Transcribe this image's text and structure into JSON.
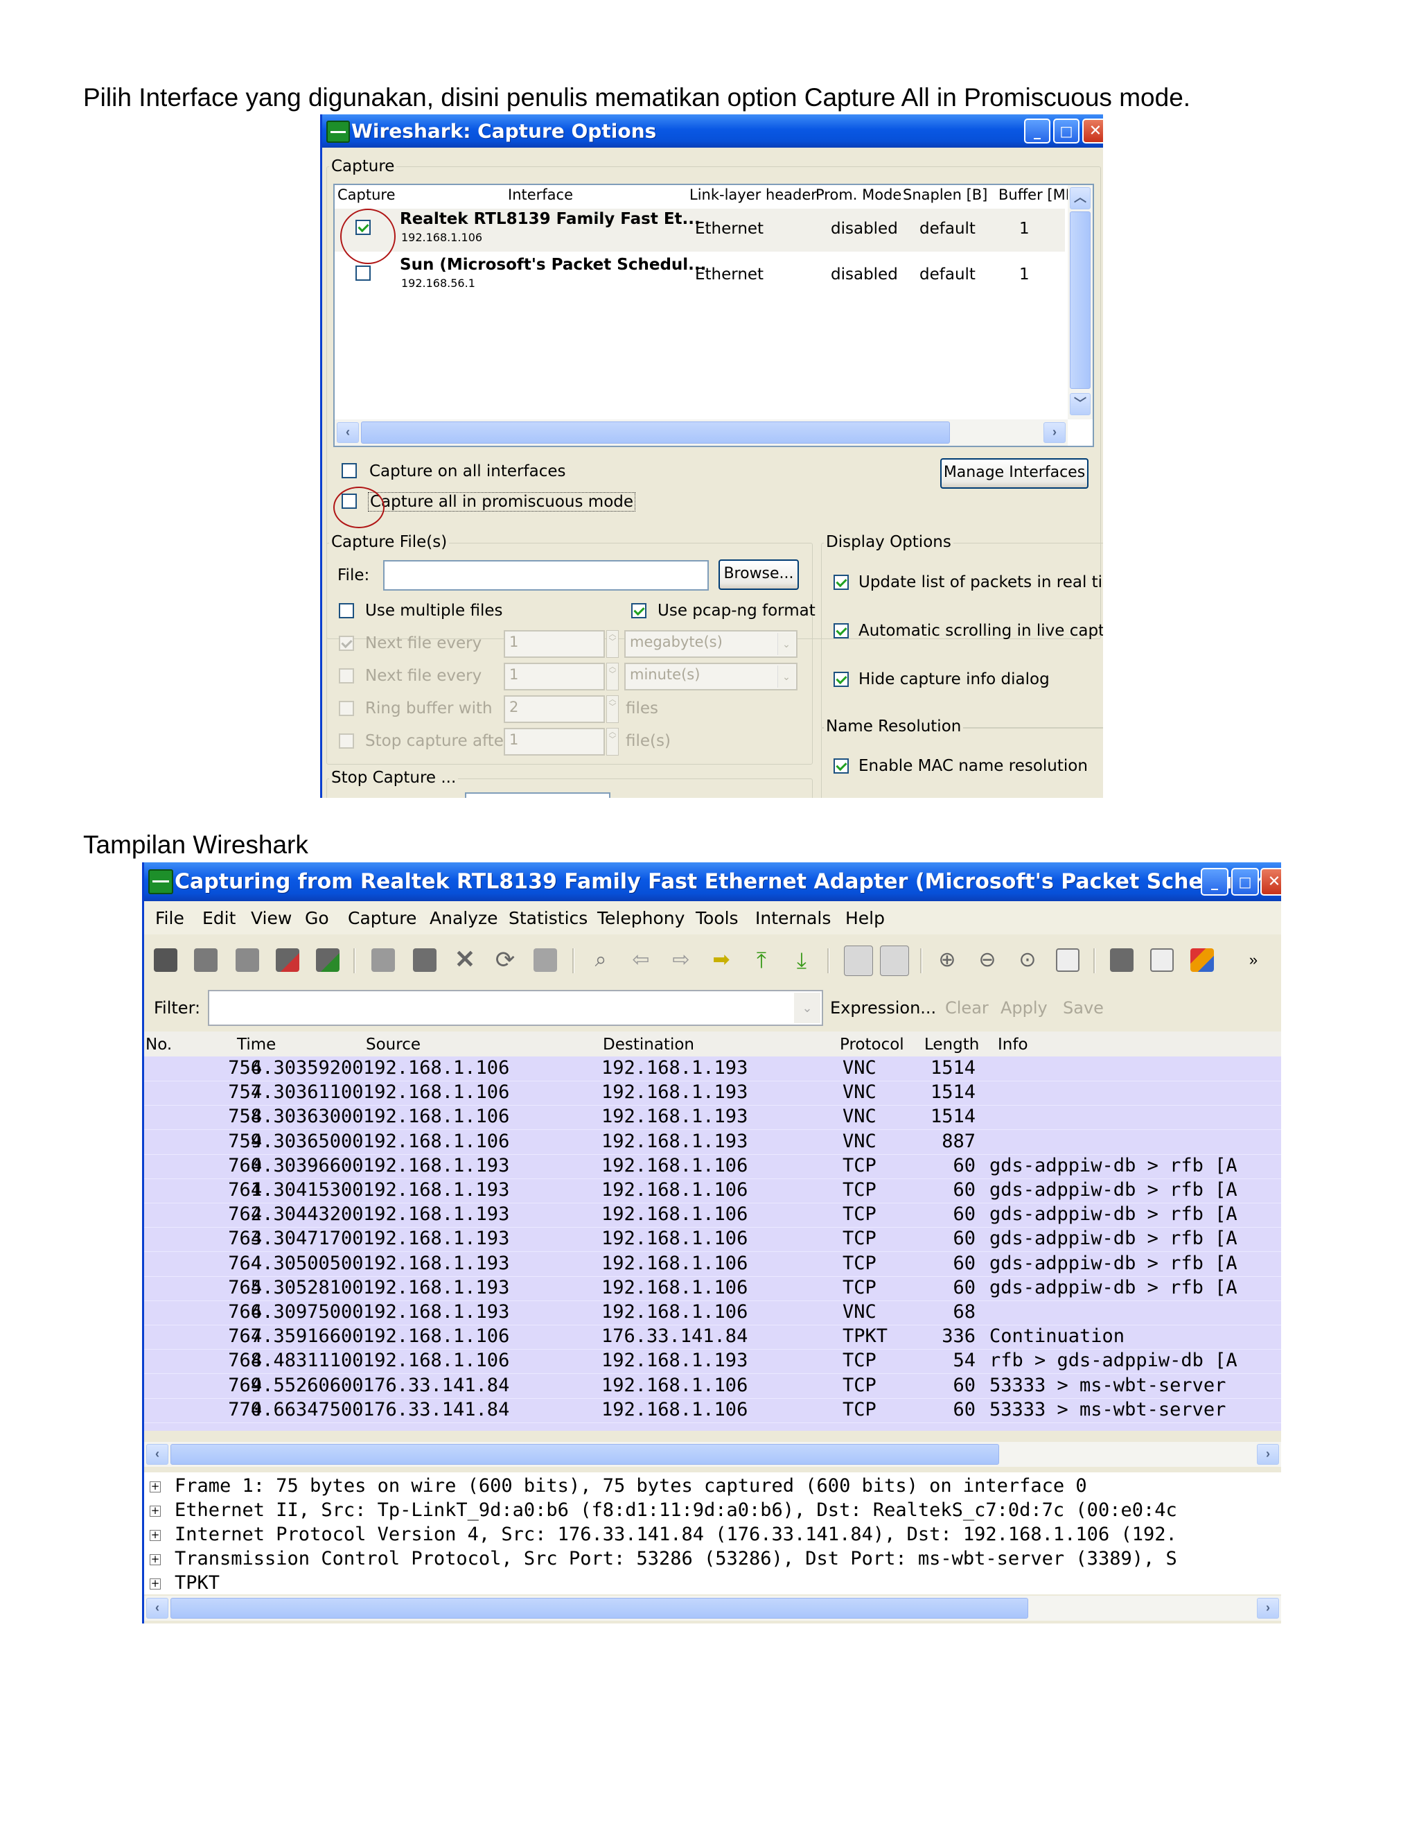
{
  "doc": {
    "intro_text": "Pilih Interface yang digunakan, disini penulis mematikan option Capture All in Promiscuous mode.",
    "section_title": "Tampilan Wireshark"
  },
  "options_dialog": {
    "title": "Wireshark: Capture Options",
    "capture_group": "Capture",
    "columns": [
      "Capture",
      "Interface",
      "Link-layer header",
      "Prom. Mode",
      "Snaplen [B]",
      "Buffer [MB"
    ],
    "interfaces": [
      {
        "name": "Realtek RTL8139 Family Fast Et...",
        "ip": "192.168.1.106",
        "link": "Ethernet",
        "prom": "disabled",
        "snaplen": "default",
        "buffer": "1",
        "checked": true
      },
      {
        "name": "Sun (Microsoft's Packet Schedul...",
        "ip": "192.168.56.1",
        "link": "Ethernet",
        "prom": "disabled",
        "snaplen": "default",
        "buffer": "1",
        "checked": false
      }
    ],
    "capture_all_interfaces": "Capture on all interfaces",
    "capture_promiscuous": "Capture all in promiscuous mode",
    "manage_interfaces": "Manage Interfaces",
    "capture_files_group": "Capture File(s)",
    "file_label": "File:",
    "file_value": "",
    "browse": "Browse...",
    "use_multiple_files": "Use multiple files",
    "use_pcapng": "Use pcap-ng format",
    "next_file_every_1": "Next file every",
    "next_file_every_1_value": "1",
    "next_file_every_1_unit": "megabyte(s)",
    "next_file_every_2": "Next file every",
    "next_file_every_2_value": "1",
    "next_file_every_2_unit": "minute(s)",
    "ring_buffer": "Ring buffer with",
    "ring_buffer_value": "2",
    "ring_buffer_unit": "files",
    "stop_capture_after": "Stop capture after",
    "stop_capture_after_value": "1",
    "stop_capture_after_unit": "file(s)",
    "stop_capture_group": "Stop Capture ...",
    "display_options_group": "Display Options",
    "update_realtime": "Update list of packets in real time",
    "auto_scroll": "Automatic scrolling in live capture",
    "hide_info": "Hide capture info dialog",
    "name_resolution_group": "Name Resolution",
    "mac_resolution": "Enable MAC name resolution"
  },
  "main_window": {
    "title": "Capturing from Realtek RTL8139 Family Fast Ethernet Adapter (Microsoft's Packet Scheduler) : \\Device\\...",
    "menu": [
      "File",
      "Edit",
      "View",
      "Go",
      "Capture",
      "Analyze",
      "Statistics",
      "Telephony",
      "Tools",
      "Internals",
      "Help"
    ],
    "filter_label": "Filter:",
    "filter_value": "",
    "expression": "Expression...",
    "clear": "Clear",
    "apply": "Apply",
    "save": "Save",
    "columns": [
      "No.",
      "Time",
      "Source",
      "Destination",
      "Protocol",
      "Length",
      "Info"
    ],
    "packets": [
      {
        "no": "756",
        "time": "4.30359200",
        "src": "192.168.1.106",
        "dst": "192.168.1.193",
        "proto": "VNC",
        "len": "1514",
        "info": ""
      },
      {
        "no": "757",
        "time": "4.30361100",
        "src": "192.168.1.106",
        "dst": "192.168.1.193",
        "proto": "VNC",
        "len": "1514",
        "info": ""
      },
      {
        "no": "758",
        "time": "4.30363000",
        "src": "192.168.1.106",
        "dst": "192.168.1.193",
        "proto": "VNC",
        "len": "1514",
        "info": ""
      },
      {
        "no": "759",
        "time": "4.30365000",
        "src": "192.168.1.106",
        "dst": "192.168.1.193",
        "proto": "VNC",
        "len": "887",
        "info": ""
      },
      {
        "no": "760",
        "time": "4.30396600",
        "src": "192.168.1.193",
        "dst": "192.168.1.106",
        "proto": "TCP",
        "len": "60",
        "info": "gds-adppiw-db > rfb [A"
      },
      {
        "no": "761",
        "time": "4.30415300",
        "src": "192.168.1.193",
        "dst": "192.168.1.106",
        "proto": "TCP",
        "len": "60",
        "info": "gds-adppiw-db > rfb [A"
      },
      {
        "no": "762",
        "time": "4.30443200",
        "src": "192.168.1.193",
        "dst": "192.168.1.106",
        "proto": "TCP",
        "len": "60",
        "info": "gds-adppiw-db > rfb [A"
      },
      {
        "no": "763",
        "time": "4.30471700",
        "src": "192.168.1.193",
        "dst": "192.168.1.106",
        "proto": "TCP",
        "len": "60",
        "info": "gds-adppiw-db > rfb [A"
      },
      {
        "no": "764",
        "time": "4.30500500",
        "src": "192.168.1.193",
        "dst": "192.168.1.106",
        "proto": "TCP",
        "len": "60",
        "info": "gds-adppiw-db > rfb [A"
      },
      {
        "no": "765",
        "time": "4.30528100",
        "src": "192.168.1.193",
        "dst": "192.168.1.106",
        "proto": "TCP",
        "len": "60",
        "info": "gds-adppiw-db > rfb [A"
      },
      {
        "no": "766",
        "time": "4.30975000",
        "src": "192.168.1.193",
        "dst": "192.168.1.106",
        "proto": "VNC",
        "len": "68",
        "info": ""
      },
      {
        "no": "767",
        "time": "4.35916600",
        "src": "192.168.1.106",
        "dst": "176.33.141.84",
        "proto": "TPKT",
        "len": "336",
        "info": "Continuation"
      },
      {
        "no": "768",
        "time": "4.48311100",
        "src": "192.168.1.106",
        "dst": "192.168.1.193",
        "proto": "TCP",
        "len": "54",
        "info": "rfb > gds-adppiw-db [A"
      },
      {
        "no": "769",
        "time": "4.55260600",
        "src": "176.33.141.84",
        "dst": "192.168.1.106",
        "proto": "TCP",
        "len": "60",
        "info": "53333 > ms-wbt-server"
      },
      {
        "no": "770",
        "time": "4.66347500",
        "src": "176.33.141.84",
        "dst": "192.168.1.106",
        "proto": "TCP",
        "len": "60",
        "info": "53333 > ms-wbt-server"
      }
    ],
    "details": [
      "Frame 1: 75 bytes on wire (600 bits), 75 bytes captured (600 bits) on interface 0",
      "Ethernet II, Src: Tp-LinkT_9d:a0:b6 (f8:d1:11:9d:a0:b6), Dst: RealtekS_c7:0d:7c (00:e0:4c",
      "Internet Protocol Version 4, Src: 176.33.141.84 (176.33.141.84), Dst: 192.168.1.106 (192.",
      "Transmission Control Protocol, Src Port: 53286 (53286), Dst Port: ms-wbt-server (3389), S",
      "TPKT"
    ],
    "colors": {
      "row_bg": "#ddd9fb",
      "title_blue": "#0a58e4"
    }
  }
}
